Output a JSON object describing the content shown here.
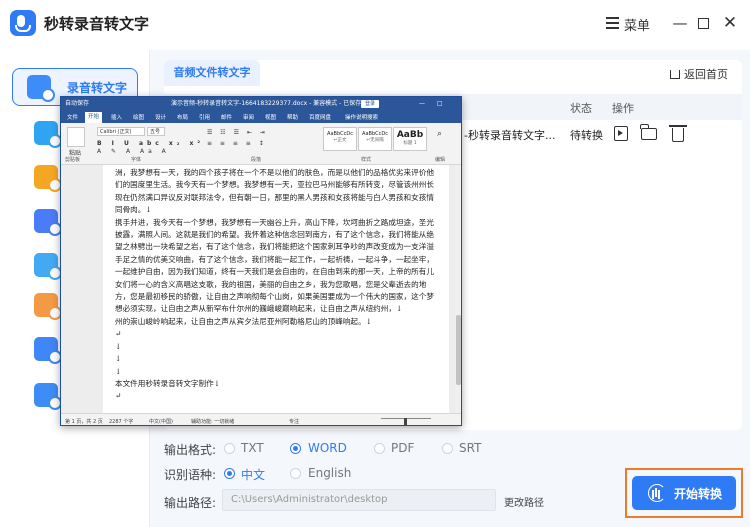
{
  "app": {
    "title": "秒转录音转文字",
    "menu_label": "菜单",
    "minimize": "—",
    "close": "✕"
  },
  "sidebar": {
    "items": [
      {
        "label": "录音转文字",
        "icon": "audio-to-text-icon",
        "active": true
      },
      {
        "label": "",
        "icon": "image-to-text-icon"
      },
      {
        "label": "",
        "icon": "text-to-speech-icon"
      },
      {
        "label": "",
        "icon": "video-to-text-icon"
      },
      {
        "label": "",
        "icon": "audio-recording-icon"
      },
      {
        "label": "",
        "icon": "audio-convert-icon"
      },
      {
        "label": "",
        "icon": "translate-icon"
      },
      {
        "label": "",
        "icon": "document-list-icon"
      }
    ]
  },
  "main": {
    "tab_label": "音频文件转文字",
    "home_link": "返回首页",
    "table": {
      "headers": {
        "status": "状态",
        "operation": "操作"
      },
      "rows": [
        {
          "file": "-秒转录音转文字...",
          "status": "待转换"
        }
      ]
    }
  },
  "word": {
    "autosave": "自动保存",
    "title": "演示音频-秒转录音转文字-1664183229377.docx - 兼容模式 - 已保存 ▾",
    "login": "登录",
    "window_controls": "— □ ✕",
    "menus": [
      "文件",
      "开始",
      "插入",
      "绘图",
      "设计",
      "布局",
      "引用",
      "邮件",
      "审阅",
      "视图",
      "帮助",
      "百度网盘",
      "操作说明搜索"
    ],
    "ribbon": {
      "paste": "粘贴",
      "clipboard": "剪贴板",
      "font_name": "Calibri (正文)",
      "font_size": "五号",
      "font_group": "字体",
      "paragraph_group": "段落",
      "styles_group": "样式",
      "edit_group": "编辑",
      "styles": [
        {
          "sample": "AaBbCcDc",
          "name": "↵正文"
        },
        {
          "sample": "AaBbCcDc",
          "name": "↵无间隔"
        },
        {
          "sample": "AaBb",
          "name": "标题 1"
        }
      ]
    },
    "paragraphs": [
      "洲，我梦想有一天，我的四个孩子将在一个不是以他们的肤色，而是以他们的品格优劣来评价他们的国度里生活。我今天有一个梦想。我梦想有一天，亚拉巴马州能够有所转变，尽管该州州长现在仍然满口异议反对联邦法令，但有朝一日，那里的黑人男孩和女孩将能与白人男孩和女孩情同骨肉。↓",
      "携手并进，我今天有一个梦想，我梦想有一天幽谷上升，高山下降，坎坷曲折之路成坦途，圣光披露，满照人间。这就是我们的希望。我怀着这种信念回到南方，有了这个信念，我们将能从绝望之林劈出一块希望之岩，有了这个信念，我们将能把这个国家刺耳争吵的声改变成为一支洋溢手足之情的优美交响曲，有了这个信念，我们将能一起工作，一起祈祷，一起斗争，一起坐牢，一起维护自由，因为我们知道，终有一天我们是会自由的，在自由到来的那一天，上帝的所有儿女们将一心的含义高唱这支歌，我的祖国，美丽的自由之乡，我为您歌唱，您是父辈逝去的地方，您是最初移民的骄傲，让自由之声响彻每个山岗，如果美国要成为一个伟大的国家，这个梦想必须实现，让自由之声从新罕布什尔州的巍峨峻巅响起来，让自由之声从纽约州，↓",
      "州的崇山峻岭响起来，让自由之声从宾夕法尼亚州阿勒格尼山的顶峰响起。↓",
      "↵",
      "↓",
      "↓",
      "↓",
      "本文件用秒转录音转文字制作↓",
      "↵"
    ],
    "status": {
      "page": "第 1 页，共 2 页",
      "words": "2287 个字",
      "lang": "中文(中国)",
      "assist": "辅助功能: 一切就绪",
      "focus": "专注",
      "zoom_pct": 40
    }
  },
  "options": {
    "format_label": "输出格式:",
    "formats": [
      {
        "label": "TXT",
        "selected": false
      },
      {
        "label": "WORD",
        "selected": true
      },
      {
        "label": "PDF",
        "selected": false
      },
      {
        "label": "SRT",
        "selected": false
      }
    ],
    "lang_label": "识别语种:",
    "langs": [
      {
        "label": "中文",
        "selected": true
      },
      {
        "label": "English",
        "selected": false
      }
    ],
    "path_label": "输出路径:",
    "path_value": "C:\\Users\\Administrator\\desktop",
    "change_path": "更改路径",
    "start_button": "开始转换"
  },
  "colors": {
    "accent": "#2f7bf6",
    "word_blue": "#2b579a",
    "highlight": "#ee7a2f"
  }
}
